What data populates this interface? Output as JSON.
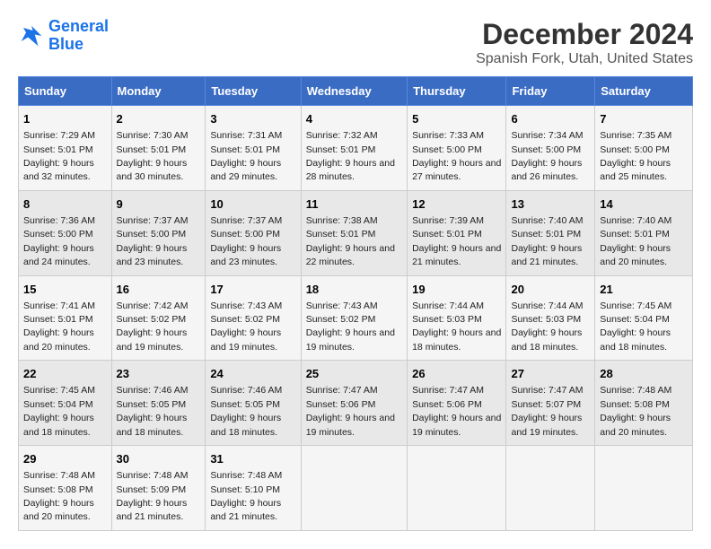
{
  "logo": {
    "line1": "General",
    "line2": "Blue"
  },
  "title": "December 2024",
  "subtitle": "Spanish Fork, Utah, United States",
  "days_of_week": [
    "Sunday",
    "Monday",
    "Tuesday",
    "Wednesday",
    "Thursday",
    "Friday",
    "Saturday"
  ],
  "weeks": [
    [
      {
        "day": "1",
        "sunrise": "Sunrise: 7:29 AM",
        "sunset": "Sunset: 5:01 PM",
        "daylight": "Daylight: 9 hours and 32 minutes."
      },
      {
        "day": "2",
        "sunrise": "Sunrise: 7:30 AM",
        "sunset": "Sunset: 5:01 PM",
        "daylight": "Daylight: 9 hours and 30 minutes."
      },
      {
        "day": "3",
        "sunrise": "Sunrise: 7:31 AM",
        "sunset": "Sunset: 5:01 PM",
        "daylight": "Daylight: 9 hours and 29 minutes."
      },
      {
        "day": "4",
        "sunrise": "Sunrise: 7:32 AM",
        "sunset": "Sunset: 5:01 PM",
        "daylight": "Daylight: 9 hours and 28 minutes."
      },
      {
        "day": "5",
        "sunrise": "Sunrise: 7:33 AM",
        "sunset": "Sunset: 5:00 PM",
        "daylight": "Daylight: 9 hours and 27 minutes."
      },
      {
        "day": "6",
        "sunrise": "Sunrise: 7:34 AM",
        "sunset": "Sunset: 5:00 PM",
        "daylight": "Daylight: 9 hours and 26 minutes."
      },
      {
        "day": "7",
        "sunrise": "Sunrise: 7:35 AM",
        "sunset": "Sunset: 5:00 PM",
        "daylight": "Daylight: 9 hours and 25 minutes."
      }
    ],
    [
      {
        "day": "8",
        "sunrise": "Sunrise: 7:36 AM",
        "sunset": "Sunset: 5:00 PM",
        "daylight": "Daylight: 9 hours and 24 minutes."
      },
      {
        "day": "9",
        "sunrise": "Sunrise: 7:37 AM",
        "sunset": "Sunset: 5:00 PM",
        "daylight": "Daylight: 9 hours and 23 minutes."
      },
      {
        "day": "10",
        "sunrise": "Sunrise: 7:37 AM",
        "sunset": "Sunset: 5:00 PM",
        "daylight": "Daylight: 9 hours and 23 minutes."
      },
      {
        "day": "11",
        "sunrise": "Sunrise: 7:38 AM",
        "sunset": "Sunset: 5:01 PM",
        "daylight": "Daylight: 9 hours and 22 minutes."
      },
      {
        "day": "12",
        "sunrise": "Sunrise: 7:39 AM",
        "sunset": "Sunset: 5:01 PM",
        "daylight": "Daylight: 9 hours and 21 minutes."
      },
      {
        "day": "13",
        "sunrise": "Sunrise: 7:40 AM",
        "sunset": "Sunset: 5:01 PM",
        "daylight": "Daylight: 9 hours and 21 minutes."
      },
      {
        "day": "14",
        "sunrise": "Sunrise: 7:40 AM",
        "sunset": "Sunset: 5:01 PM",
        "daylight": "Daylight: 9 hours and 20 minutes."
      }
    ],
    [
      {
        "day": "15",
        "sunrise": "Sunrise: 7:41 AM",
        "sunset": "Sunset: 5:01 PM",
        "daylight": "Daylight: 9 hours and 20 minutes."
      },
      {
        "day": "16",
        "sunrise": "Sunrise: 7:42 AM",
        "sunset": "Sunset: 5:02 PM",
        "daylight": "Daylight: 9 hours and 19 minutes."
      },
      {
        "day": "17",
        "sunrise": "Sunrise: 7:43 AM",
        "sunset": "Sunset: 5:02 PM",
        "daylight": "Daylight: 9 hours and 19 minutes."
      },
      {
        "day": "18",
        "sunrise": "Sunrise: 7:43 AM",
        "sunset": "Sunset: 5:02 PM",
        "daylight": "Daylight: 9 hours and 19 minutes."
      },
      {
        "day": "19",
        "sunrise": "Sunrise: 7:44 AM",
        "sunset": "Sunset: 5:03 PM",
        "daylight": "Daylight: 9 hours and 18 minutes."
      },
      {
        "day": "20",
        "sunrise": "Sunrise: 7:44 AM",
        "sunset": "Sunset: 5:03 PM",
        "daylight": "Daylight: 9 hours and 18 minutes."
      },
      {
        "day": "21",
        "sunrise": "Sunrise: 7:45 AM",
        "sunset": "Sunset: 5:04 PM",
        "daylight": "Daylight: 9 hours and 18 minutes."
      }
    ],
    [
      {
        "day": "22",
        "sunrise": "Sunrise: 7:45 AM",
        "sunset": "Sunset: 5:04 PM",
        "daylight": "Daylight: 9 hours and 18 minutes."
      },
      {
        "day": "23",
        "sunrise": "Sunrise: 7:46 AM",
        "sunset": "Sunset: 5:05 PM",
        "daylight": "Daylight: 9 hours and 18 minutes."
      },
      {
        "day": "24",
        "sunrise": "Sunrise: 7:46 AM",
        "sunset": "Sunset: 5:05 PM",
        "daylight": "Daylight: 9 hours and 18 minutes."
      },
      {
        "day": "25",
        "sunrise": "Sunrise: 7:47 AM",
        "sunset": "Sunset: 5:06 PM",
        "daylight": "Daylight: 9 hours and 19 minutes."
      },
      {
        "day": "26",
        "sunrise": "Sunrise: 7:47 AM",
        "sunset": "Sunset: 5:06 PM",
        "daylight": "Daylight: 9 hours and 19 minutes."
      },
      {
        "day": "27",
        "sunrise": "Sunrise: 7:47 AM",
        "sunset": "Sunset: 5:07 PM",
        "daylight": "Daylight: 9 hours and 19 minutes."
      },
      {
        "day": "28",
        "sunrise": "Sunrise: 7:48 AM",
        "sunset": "Sunset: 5:08 PM",
        "daylight": "Daylight: 9 hours and 20 minutes."
      }
    ],
    [
      {
        "day": "29",
        "sunrise": "Sunrise: 7:48 AM",
        "sunset": "Sunset: 5:08 PM",
        "daylight": "Daylight: 9 hours and 20 minutes."
      },
      {
        "day": "30",
        "sunrise": "Sunrise: 7:48 AM",
        "sunset": "Sunset: 5:09 PM",
        "daylight": "Daylight: 9 hours and 21 minutes."
      },
      {
        "day": "31",
        "sunrise": "Sunrise: 7:48 AM",
        "sunset": "Sunset: 5:10 PM",
        "daylight": "Daylight: 9 hours and 21 minutes."
      },
      null,
      null,
      null,
      null
    ]
  ]
}
